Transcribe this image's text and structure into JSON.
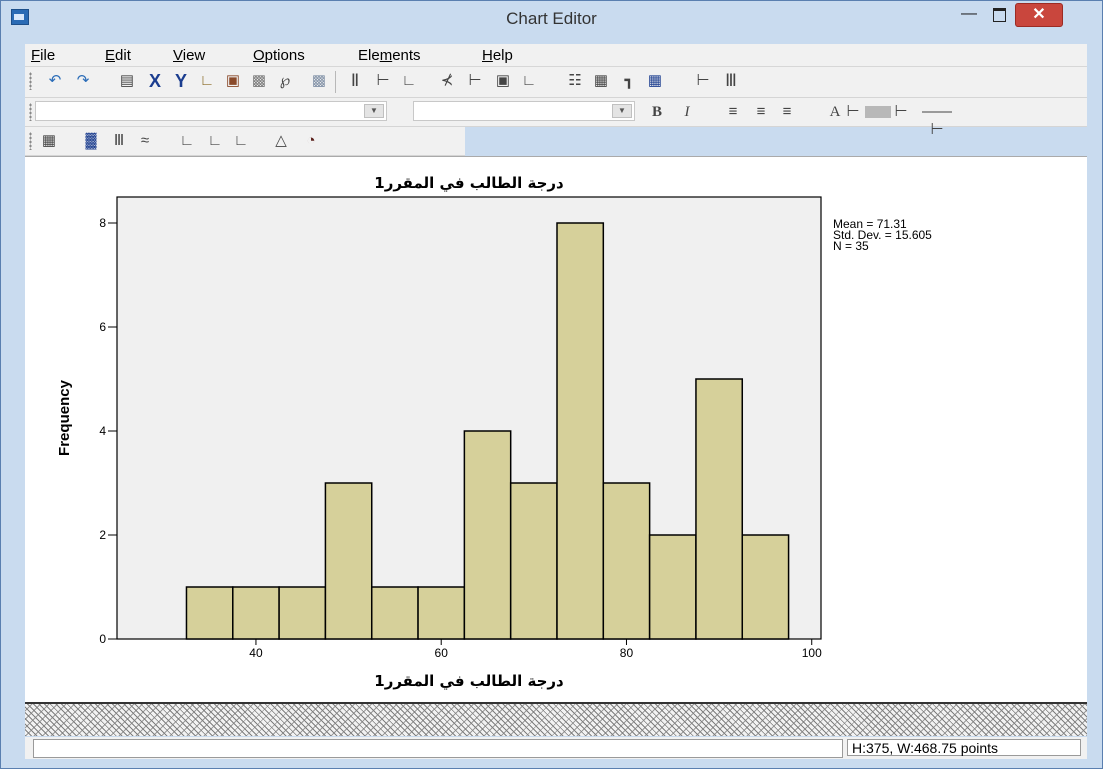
{
  "window": {
    "title": "Chart Editor"
  },
  "menubar": {
    "items": [
      {
        "pre": "",
        "u": "F",
        "post": "ile"
      },
      {
        "pre": "",
        "u": "E",
        "post": "dit"
      },
      {
        "pre": "",
        "u": "V",
        "post": "iew"
      },
      {
        "pre": "",
        "u": "O",
        "post": "ptions"
      },
      {
        "pre": "Ele",
        "u": "m",
        "post": "ents"
      },
      {
        "pre": "",
        "u": "H",
        "post": "elp"
      }
    ]
  },
  "toolbar2": {
    "bold_label": "B",
    "italic_label": "I",
    "font_color_label": "A"
  },
  "toolbar_icons": {
    "row1": [
      "undo-icon",
      "redo-icon",
      "properties-icon",
      "x-axis-icon",
      "y-axis-icon",
      "rescale-icon",
      "zoom-icon",
      "3d-icon",
      "lasso-icon",
      "select-icon",
      "y-chart-icon",
      "x-axis-chart-icon",
      "diagonal-icon",
      "reference-line-icon",
      "title-icon",
      "text-box-icon",
      "footnote-icon",
      "grid-icon",
      "table-icon",
      "bar-icon",
      "legend-icon",
      "transpose-icon",
      "columns-icon"
    ],
    "row3": [
      "binning-icon",
      "bar-chart-icon",
      "clustered-bar-icon",
      "line-icon",
      "scatter-icon",
      "fit-line-icon",
      "area-icon",
      "pie-icon"
    ]
  },
  "chart_data": {
    "type": "bar",
    "title": "درجة الطالب في المقرر1",
    "xlabel": "درجة الطالب في المقرر1",
    "ylabel": "Frequency",
    "categories": [
      "35",
      "40",
      "45",
      "50",
      "55",
      "60",
      "65",
      "70",
      "75",
      "80",
      "85",
      "90",
      "95"
    ],
    "bin_width": 5,
    "values": [
      1,
      1,
      1,
      3,
      1,
      1,
      4,
      3,
      8,
      3,
      2,
      5,
      2
    ],
    "xlim": [
      25,
      101
    ],
    "ylim": [
      0,
      8.5
    ],
    "x_ticks": [
      40,
      60,
      80,
      100
    ],
    "y_ticks": [
      0,
      2,
      4,
      6,
      8
    ],
    "bar_color": "#d6d09a",
    "plot_bg": "#f0f0f0",
    "stats": [
      "Mean = 71.31",
      "Std. Dev. = 15.605",
      "N = 35"
    ]
  },
  "statusbar": {
    "dimensions": "H:375, W:468.75 points"
  }
}
